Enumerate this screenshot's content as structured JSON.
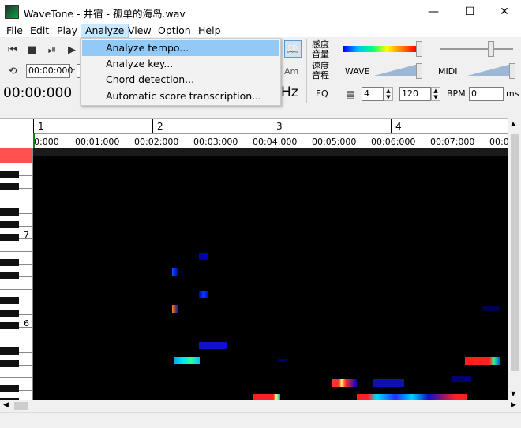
{
  "window": {
    "title": "WaveTone - 井宿 - 孤单的海岛.wav",
    "controls": [
      "—",
      "☐",
      "✕"
    ]
  },
  "menu": [
    "File",
    "Edit",
    "Play",
    "Analyze",
    "View",
    "Option",
    "Help"
  ],
  "analyze_menu": {
    "items": [
      "Analyze tempo...",
      "Analyze key...",
      "Chord detection...",
      "Automatic score transcription..."
    ],
    "highlighted": "Analyze tempo..."
  },
  "toolbar": {
    "loop_start": "00:00:000",
    "time_display": "00:00:000",
    "hz_label": "Hz",
    "am_label": "Am",
    "eq_label": "EQ",
    "sensitivity_label": "感度音量",
    "speed_label": "速度音程",
    "wave_label": "WAVE",
    "midi_label": "MIDI",
    "beats": "4",
    "tempo": "120",
    "bpm_label": "BPM",
    "offset": "0",
    "ms_label": "ms"
  },
  "timeline": {
    "measures": [
      "1",
      "2",
      "3",
      "4"
    ],
    "times": [
      "0:000",
      "00:01:000",
      "00:02:000",
      "00:03:000",
      "00:04:000",
      "00:05:000",
      "00:06:000",
      "00:07:000",
      "00:0"
    ]
  },
  "keyboard": {
    "octave_labels": [
      "7",
      "6"
    ]
  },
  "spectrogram": {
    "colors": {
      "low": "#0000c8",
      "mid": "#00d0ff",
      "high": "#ff2020",
      "green": "#30ff80"
    }
  }
}
